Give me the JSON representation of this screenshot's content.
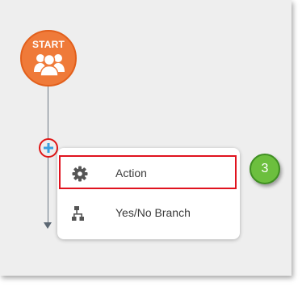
{
  "start_node": {
    "label": "START",
    "icon": "users-group-icon",
    "color": "#ef7a39"
  },
  "add_button": {
    "icon": "plus-icon",
    "color": "#3aa0df",
    "highlight_color": "#e01616"
  },
  "menu": {
    "items": [
      {
        "label": "Action",
        "icon": "gear-icon"
      },
      {
        "label": "Yes/No Branch",
        "icon": "branch-icon"
      }
    ]
  },
  "step_badge": {
    "number": "3",
    "color": "#6cbf3e"
  }
}
